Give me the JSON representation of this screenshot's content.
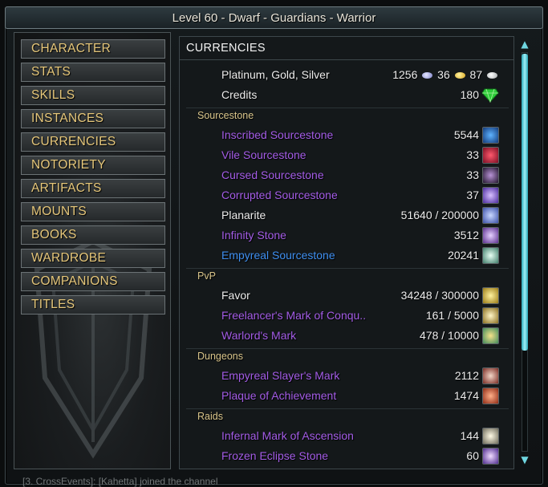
{
  "window": {
    "title": "Level 60 - Dwarf - Guardians - Warrior"
  },
  "nav": {
    "items": [
      "CHARACTER",
      "STATS",
      "SKILLS",
      "INSTANCES",
      "CURRENCIES",
      "NOTORIETY",
      "ARTIFACTS",
      "MOUNTS",
      "BOOKS",
      "WARDROBE",
      "COMPANIONS",
      "TITLES"
    ],
    "selected": "CURRENCIES"
  },
  "panel": {
    "heading": "CURRENCIES"
  },
  "money": {
    "label": "Platinum, Gold, Silver",
    "platinum": "1256",
    "gold": "36",
    "silver": "87"
  },
  "credits": {
    "label": "Credits",
    "value": "180"
  },
  "categories": {
    "sourcestone": "Sourcestone",
    "pvp": "PvP",
    "dungeons": "Dungeons",
    "raids": "Raids"
  },
  "rows": {
    "inscribed": {
      "name": "Inscribed Sourcestone",
      "value": "5544",
      "icon": "blue-rune-icon"
    },
    "vile": {
      "name": "Vile Sourcestone",
      "value": "33",
      "icon": "red-stone-icon"
    },
    "cursed": {
      "name": "Cursed Sourcestone",
      "value": "33",
      "icon": "dark-star-icon"
    },
    "corrupted": {
      "name": "Corrupted Sourcestone",
      "value": "37",
      "icon": "purple-orb-icon"
    },
    "planarite": {
      "name": "Planarite",
      "value": "51640 / 200000",
      "icon": "planarite-orb-icon"
    },
    "infinity": {
      "name": "Infinity Stone",
      "value": "3512",
      "icon": "infinity-stone-icon"
    },
    "empyreal": {
      "name": "Empyreal Sourcestone",
      "value": "20241",
      "icon": "empyreal-stone-icon"
    },
    "favor": {
      "name": "Favor",
      "value": "34248 / 300000",
      "icon": "favor-coin-icon"
    },
    "freelancer": {
      "name": "Freelancer's Mark of Conqu..",
      "value": "161 / 5000",
      "icon": "gold-star-icon"
    },
    "warlord": {
      "name": "Warlord's Mark",
      "value": "478 / 10000",
      "icon": "warlord-mark-icon"
    },
    "slayer": {
      "name": "Empyreal Slayer's Mark",
      "value": "2112",
      "icon": "skull-mark-icon"
    },
    "plaque": {
      "name": "Plaque of Achievement",
      "value": "1474",
      "icon": "plaque-icon"
    },
    "infernal": {
      "name": "Infernal Mark of Ascension",
      "value": "144",
      "icon": "claw-mark-icon"
    },
    "frozen": {
      "name": "Frozen Eclipse Stone",
      "value": "60",
      "icon": "eclipse-stone-icon"
    }
  },
  "colors": {
    "nav_text": "#e6c77a",
    "currency_name": "#a35ce6",
    "empyreal_name": "#3f8ff0",
    "category_text": "#d9c58b",
    "scroll_accent": "#6fd6e0"
  },
  "chat": {
    "partial_text": "[3. CrossEvents]: [Kahetta] joined the channel"
  }
}
